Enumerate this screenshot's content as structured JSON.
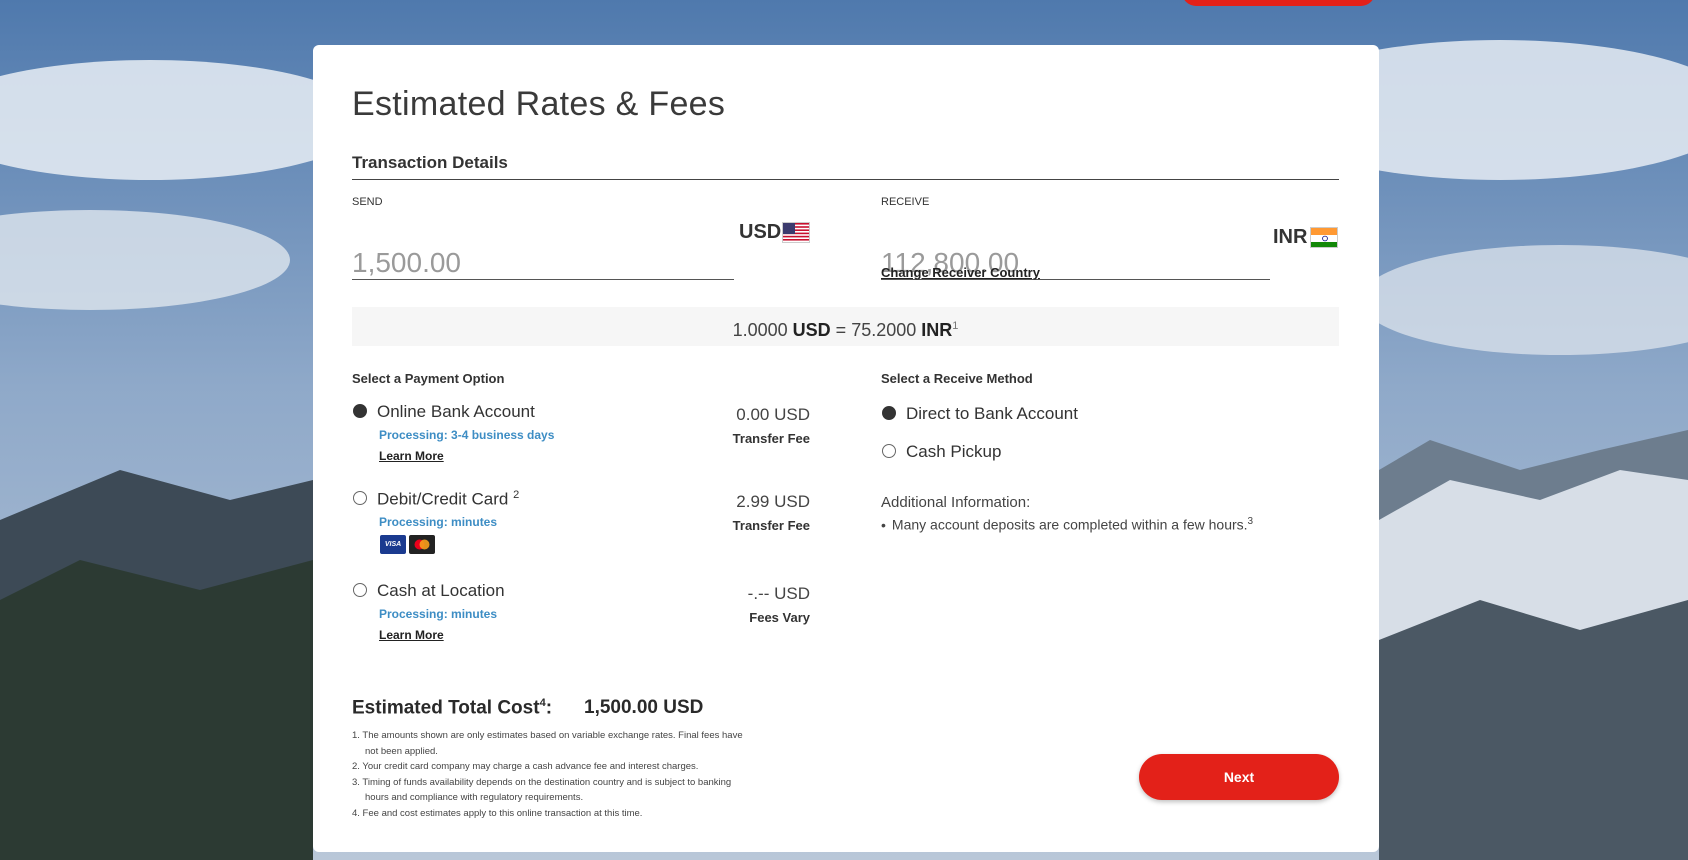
{
  "colors": {
    "accent": "#e32119",
    "processing": "#3d8dc4"
  },
  "title": "Estimated Rates & Fees",
  "transaction": {
    "heading": "Transaction Details",
    "send": {
      "label": "SEND",
      "amount": "1,500.00",
      "currency": "USD",
      "flag_icon": "us-flag-icon"
    },
    "receive": {
      "label": "RECEIVE",
      "amount": "112,800.00",
      "currency": "INR",
      "flag_icon": "india-flag-icon",
      "change_link": "Change Receiver Country"
    }
  },
  "rate": {
    "base_amount": "1.0000",
    "base_currency": "USD",
    "equals": "=",
    "quote_amount": "75.2000",
    "quote_currency": "INR",
    "footnote": "1"
  },
  "payment": {
    "heading": "Select a Payment Option",
    "options": [
      {
        "label": "Online Bank Account",
        "footnote": "",
        "processing": "Processing: 3-4 business days",
        "learn_more": "Learn More",
        "fee": "0.00 USD",
        "fee_label": "Transfer Fee",
        "selected": true
      },
      {
        "label": "Debit/Credit Card",
        "footnote": "2",
        "processing": "Processing: minutes",
        "fee": "2.99 USD",
        "fee_label": "Transfer Fee",
        "selected": false,
        "card_icons": [
          "visa-icon",
          "mastercard-icon"
        ],
        "visa_text": "VISA"
      },
      {
        "label": "Cash at Location",
        "footnote": "",
        "processing": "Processing: minutes",
        "learn_more": "Learn More",
        "fee": "-.-- USD",
        "fee_label": "Fees Vary",
        "selected": false
      }
    ]
  },
  "receive_method": {
    "heading": "Select a Receive Method",
    "options": [
      {
        "label": "Direct to Bank Account",
        "selected": true
      },
      {
        "label": "Cash Pickup",
        "selected": false
      }
    ],
    "info_heading": "Additional Information:",
    "info_items": [
      {
        "text": "Many account deposits are completed within a few hours.",
        "footnote": "3"
      }
    ]
  },
  "total": {
    "label": "Estimated Total Cost",
    "footnote": "4",
    "suffix": ":",
    "value": "1,500.00 USD"
  },
  "notes": [
    "1. The amounts shown are only estimates based on variable exchange rates. Final fees have not been applied.",
    "2. Your credit card company may charge a cash advance fee and interest charges.",
    "3. Timing of funds availability depends on the destination country and is subject to banking hours and compliance with regulatory requirements.",
    "4. Fee and cost estimates apply to this online transaction at this time."
  ],
  "next_button": "Next"
}
